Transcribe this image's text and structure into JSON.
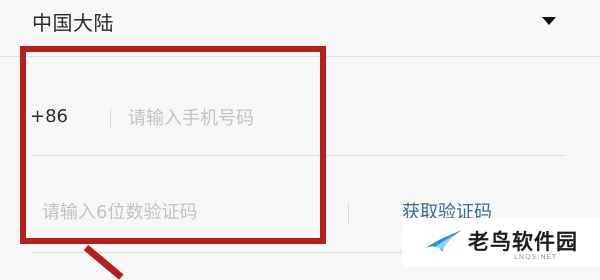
{
  "region": {
    "label": "中国大陆",
    "caret_icon": "caret-down-icon"
  },
  "phone": {
    "country_code": "+86",
    "placeholder": "请输入手机号码",
    "value": ""
  },
  "verification": {
    "placeholder": "请输入6位数验证码",
    "value": "",
    "get_code_label": "获取验证码"
  },
  "watermark": {
    "logo_icon": "bird-logo-icon",
    "text": "老鸟软件园",
    "subtext": "LNQS.NET"
  },
  "colors": {
    "accent_link": "#3b6b97",
    "highlight": "#b1211f",
    "placeholder": "#c2c2c2"
  }
}
